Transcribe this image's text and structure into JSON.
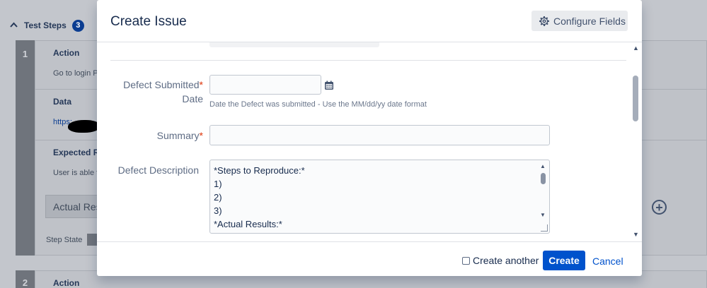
{
  "background": {
    "test_steps_label": "Test Steps",
    "test_steps_count": "3",
    "steps": [
      {
        "number": "1",
        "action_title": "Action",
        "action_value": "Go to login P",
        "data_title": "Data",
        "data_value": "https:",
        "expected_title": "Expected Re",
        "expected_value": "User is able to",
        "actual_label": "Actual Res",
        "step_state_label": "Step State"
      },
      {
        "number": "2",
        "action_title": "Action"
      }
    ]
  },
  "modal": {
    "title": "Create Issue",
    "configure_fields_label": "Configure Fields",
    "fields": {
      "defect_date": {
        "label_line1": "Defect Submitted",
        "label_line2": "Date",
        "required_marker": "*",
        "value": "",
        "description": "Date the Defect was submitted - Use the MM/dd/yy date format"
      },
      "summary": {
        "label": "Summary",
        "required_marker": "*",
        "value": ""
      },
      "defect_description": {
        "label": "Defect Description",
        "lines": [
          "*Steps to Reproduce:*",
          "1)",
          "2)",
          "3)",
          "*Actual Results:*"
        ]
      }
    },
    "footer": {
      "create_another_label": "Create another",
      "create_another_checked": false,
      "create_label": "Create",
      "cancel_label": "Cancel"
    }
  },
  "colors": {
    "primary": "#0052cc",
    "required": "#de350b",
    "badge": "#0b3d91"
  },
  "icons": {
    "configure": "gear-icon",
    "date_picker": "calendar-icon",
    "add_step": "plus-circle-icon",
    "collapse": "chevron-up-icon"
  }
}
